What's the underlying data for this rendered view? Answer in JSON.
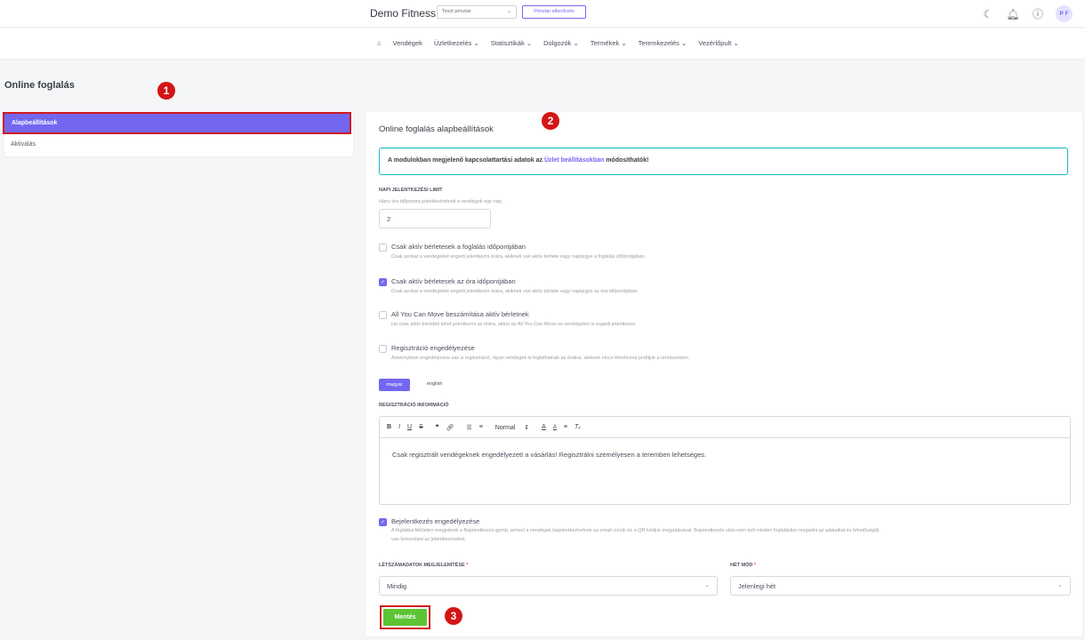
{
  "topbar": {
    "brand": "Demo Fitness",
    "cash_select": "Teszt pénztár",
    "cash_check": "Pénztár ellenőrzés",
    "avatar": "P F"
  },
  "nav": {
    "items": [
      "Vendégek",
      "Üzletkezelés ⌄",
      "Statisztikák ⌄",
      "Dolgozók ⌄",
      "Termékek ⌄",
      "Teremkezelés ⌄",
      "Vezérlőpult ⌄"
    ]
  },
  "page": {
    "title": "Online foglalás"
  },
  "sidebar": {
    "items": [
      {
        "label": "Alapbeállítások"
      },
      {
        "label": "Aktiválás"
      }
    ]
  },
  "markers": [
    "1",
    "2",
    "3"
  ],
  "main": {
    "title": "Online foglalás alapbeállítások",
    "info_before": "A modulokban megjelenő kapcsolattartási adatok az ",
    "info_link": "Üzlet beállításokban",
    "info_after": " módosíthatók!",
    "limit_label": "NAPI JELENTKEZÉSI LIMIT",
    "limit_hint": "Hány óra időpontra jelentkezhetnek a vendégek egy nap.",
    "limit_value": "2",
    "options": [
      {
        "label": "Csak aktív bérletesek a foglalás időpontjában",
        "hint": "Csak azokat a vendégeket engedi jelentkezni órára, akiknek van aktív bérlete vagy napijegye a foglalás időpontjában.",
        "checked": false
      },
      {
        "label": "Csak aktív bérletesek az óra időpontjában",
        "hint": "Csak azokat a vendégeket engedi jelentkezni órára, akiknek van aktív bérlete vagy napijegye az óra időpontjában.",
        "checked": true
      },
      {
        "label": "All You Can Move beszámítása aktív bérletnek",
        "hint": "Ha csak aktív bérlettel lehet jelentkezni az órára, akkor az All You Can Move-os vendégeket is engedi jelentkezni.",
        "checked": false
      },
      {
        "label": "Regisztráció engedélyezése",
        "hint": "Amennyiben engedélyezve van a regisztráció, olyan vendégek is foglalhatnak az órákra, akiknek nincs létrehozva profiljuk a rendszerben.",
        "checked": false
      }
    ],
    "lang_active": "magyar",
    "lang_other": "english",
    "reg_info_label": "REGISZTRÁCIÓ INFORMÁCIÓ",
    "editor_format": "Normal",
    "editor_text": "Csak regisztrált vendégeknek engedélyezett a vásárlás! Regisztrálni személyesen a teremben lehetséges.",
    "login_label": "Bejelentkezés engedélyezése",
    "login_hint_1": "A foglalási felületen megjelenik a Bejelentkezés gomb, amivel a vendégek bejelentkezhetnek az email címük és a QR kódjuk megadásával. Bejelentkezés után nem kell minden foglaláskor megadni az adataikat és lehetőségük",
    "login_hint_2": "van lemondani az jelentkezéseket.",
    "login_checked": true,
    "count_label": "LÉTSZÁMADATOK MEGJELENÍTÉSE",
    "count_value": "Mindig",
    "week_label": "HÉT MÓD",
    "week_value": "Jelenlegi hét",
    "required_mark": "*",
    "save": "Mentés"
  },
  "colors": {
    "accent": "#7367f0",
    "save": "#5dc435",
    "highlight_border": "#d21b1b",
    "marker": "#d31515",
    "info_border": "#14b8c9"
  }
}
